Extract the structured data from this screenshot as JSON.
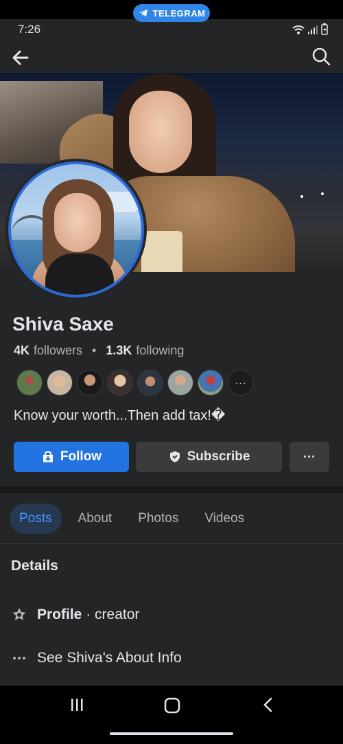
{
  "topbar": {
    "pill_label": "TELEGRAM"
  },
  "status": {
    "time": "7:26"
  },
  "profile": {
    "name": "Shiva Saxe",
    "followers_count": "4K",
    "followers_label": "followers",
    "following_count": "1.3K",
    "following_label": "following",
    "bio": "Know your worth...Then add tax!�",
    "friends_more": "···"
  },
  "actions": {
    "follow_label": "Follow",
    "subscribe_label": "Subscribe",
    "more_label": "···"
  },
  "tabs": [
    {
      "label": "Posts",
      "active": true
    },
    {
      "label": "About"
    },
    {
      "label": "Photos"
    },
    {
      "label": "Videos"
    }
  ],
  "details": {
    "title": "Details",
    "profile_label": "Profile",
    "profile_value": "· creator",
    "about_link": "See Shiva's About Info"
  },
  "colors": {
    "accent": "#2374e1",
    "active_tab_bg": "#263951",
    "active_tab_text": "#4599ff",
    "avatar_ring": "#2d6ad8",
    "telegram": "#2f86e6"
  }
}
